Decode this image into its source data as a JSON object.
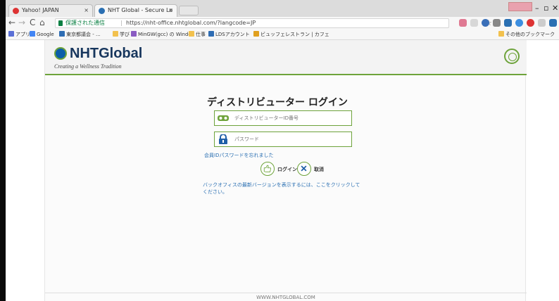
{
  "browser": {
    "tabs": [
      {
        "title": "Yahoo! JAPAN",
        "close": "×"
      },
      {
        "title": "NHT Global - Secure Lo",
        "close": "×"
      }
    ],
    "window_badge": "",
    "window_controls": {
      "minimize": "–",
      "maximize": "▫",
      "close": "✕"
    },
    "nav": {
      "back": "←",
      "forward": "→",
      "reload": "C",
      "home": "⌂"
    },
    "address": {
      "secure_label": "保護された通信",
      "separator": "|",
      "url": "https://nht-office.nhtglobal.com/?langcode=JP",
      "bookmark_star": "☆"
    },
    "bookmarks": [
      {
        "label": "アプリ",
        "color": "#5a6fd6"
      },
      {
        "label": "Google",
        "color": "#4285f4"
      },
      {
        "label": "東京都議会 - ...",
        "color": "#2f6db3"
      },
      {
        "label": "学び",
        "color": "#f2c14e"
      },
      {
        "label": "MinGW(gcc) の Windo",
        "color": "#8a5cc2"
      },
      {
        "label": "仕事",
        "color": "#f2c14e"
      },
      {
        "label": "LDSアカウント",
        "color": "#2f6db3"
      },
      {
        "label": "ビュッフェレストラン | カフェ",
        "color": "#e0a020"
      },
      {
        "label": "その他のブックマーク",
        "color": "#f2c14e"
      }
    ]
  },
  "site": {
    "logo_text": "NHTGlobal",
    "logo_tagline": "Creating a Wellness Tradition",
    "globe_icon": "globe-icon",
    "login": {
      "title": "ディストリビューター ログイン",
      "id_placeholder": "ディストリビューターID番号",
      "password_placeholder": "パスワード",
      "forgot_link": "会員IDパスワードを忘れました",
      "login_label": "ログイン",
      "cancel_label": "取消",
      "hint_text": "バックオフィスの最新バージョンを表示するには、ここをクリックしてください。"
    },
    "footer_text": "WWW.NHTGLOBAL.COM",
    "colors": {
      "accent_green": "#6ea33b",
      "brand_blue": "#17365d",
      "link_blue": "#2a6fb2"
    }
  }
}
